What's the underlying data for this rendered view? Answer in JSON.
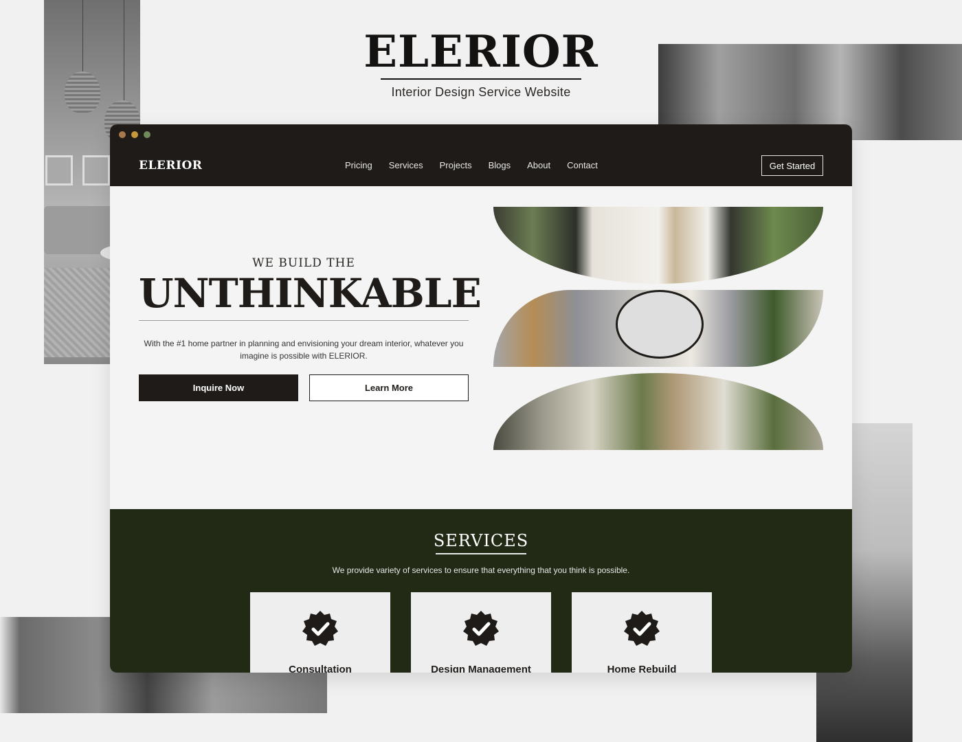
{
  "brand": {
    "title": "ELERIOR",
    "subtitle": "Interior Design Service Website"
  },
  "browser": {
    "window_dots": [
      "brown",
      "amber",
      "green"
    ]
  },
  "navbar": {
    "logo": "ELERIOR",
    "links": [
      "Pricing",
      "Services",
      "Projects",
      "Blogs",
      "About",
      "Contact"
    ],
    "cta_label": "Get Started"
  },
  "hero": {
    "kicker": "WE BUILD THE",
    "title": "UNTHINKABLE",
    "description": "With the #1 home partner in planning and envisioning your dream interior, whatever you imagine is possible with ELERIOR.",
    "primary_button": "Inquire Now",
    "secondary_button": "Learn More"
  },
  "services": {
    "title": "SERVICES",
    "description": "We provide variety of services to ensure that everything that you think is possible.",
    "cards": [
      {
        "label": "Consultation",
        "icon": "verified-badge-icon"
      },
      {
        "label": "Design Management",
        "icon": "verified-badge-icon"
      },
      {
        "label": "Home Rebuild",
        "icon": "verified-badge-icon"
      }
    ]
  },
  "colors": {
    "dark": "#1e1b18",
    "services_green": "#222a16",
    "background": "#f1f1f1"
  }
}
